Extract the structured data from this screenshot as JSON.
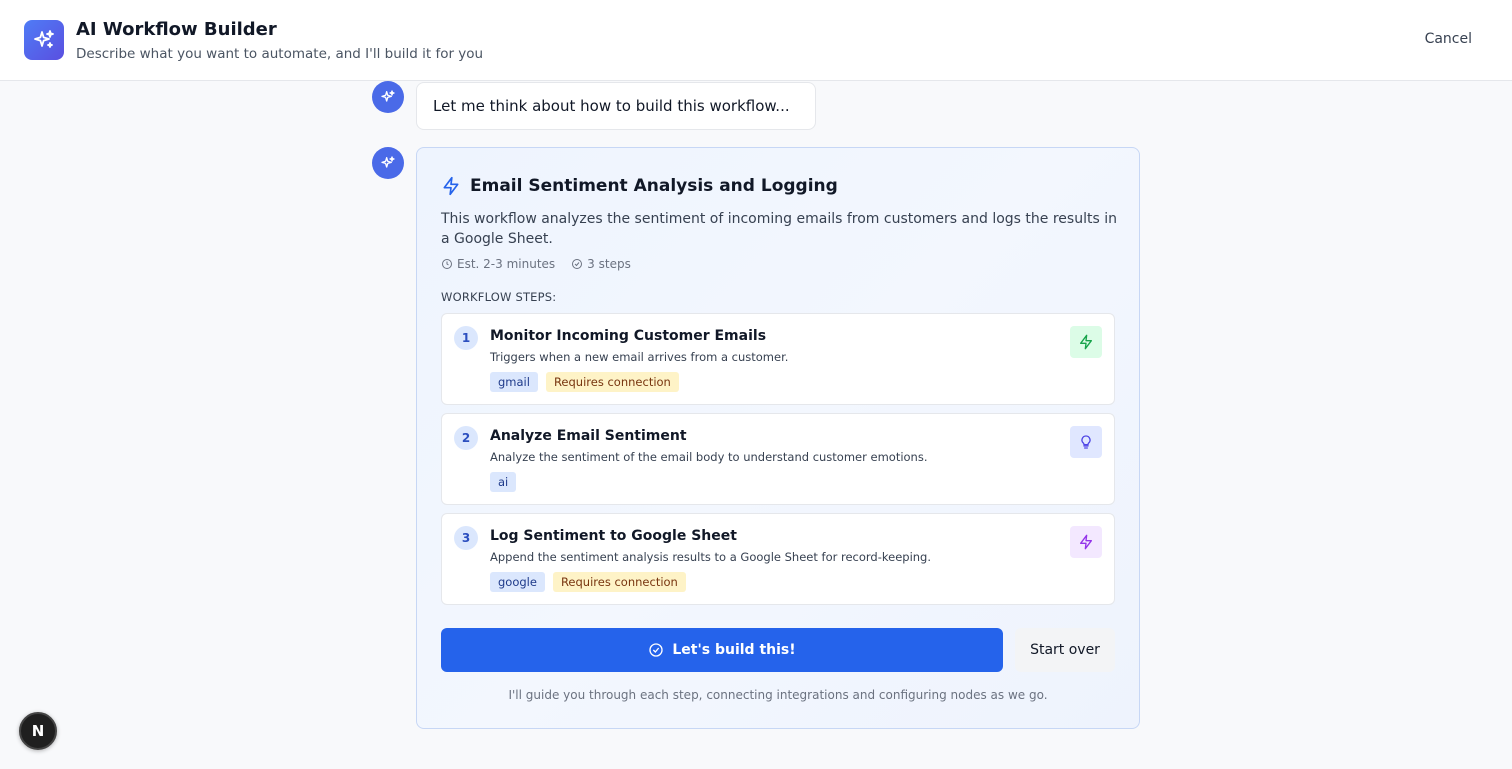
{
  "header": {
    "title": "AI Workflow Builder",
    "subtitle": "Describe what you want to automate, and I'll build it for you",
    "cancel_label": "Cancel"
  },
  "messages": {
    "thinking": "Let me think about how to build this workflow..."
  },
  "workflow": {
    "title": "Email Sentiment Analysis and Logging",
    "description": "This workflow analyzes the sentiment of incoming emails from customers and logs the results in a Google Sheet.",
    "estimate": "Est. 2-3 minutes",
    "step_count": "3 steps",
    "steps_label": "WORKFLOW STEPS:",
    "steps": [
      {
        "number": "1",
        "title": "Monitor Incoming Customer Emails",
        "description": "Triggers when a new email arrives from a customer.",
        "provider": "gmail",
        "requirement": "Requires connection",
        "icon": "lightning-icon",
        "icon_color": "#16a34a",
        "icon_bg": "#dcfce7"
      },
      {
        "number": "2",
        "title": "Analyze Email Sentiment",
        "description": "Analyze the sentiment of the email body to understand customer emotions.",
        "provider": "ai",
        "icon": "lightbulb-icon",
        "icon_color": "#4f46e5",
        "icon_bg": "#e0e7ff"
      },
      {
        "number": "3",
        "title": "Log Sentiment to Google Sheet",
        "description": "Append the sentiment analysis results to a Google Sheet for record-keeping.",
        "provider": "google",
        "requirement": "Requires connection",
        "icon": "lightning-icon",
        "icon_color": "#9333ea",
        "icon_bg": "#f3e8ff"
      }
    ],
    "build_label": "Let's build this!",
    "start_over_label": "Start over",
    "footnote": "I'll guide you through each step, connecting integrations and configuring nodes as we go."
  },
  "colors": {
    "accent": "#2563eb",
    "logo": "#4f7cf6"
  },
  "badge": {
    "letter": "N"
  }
}
